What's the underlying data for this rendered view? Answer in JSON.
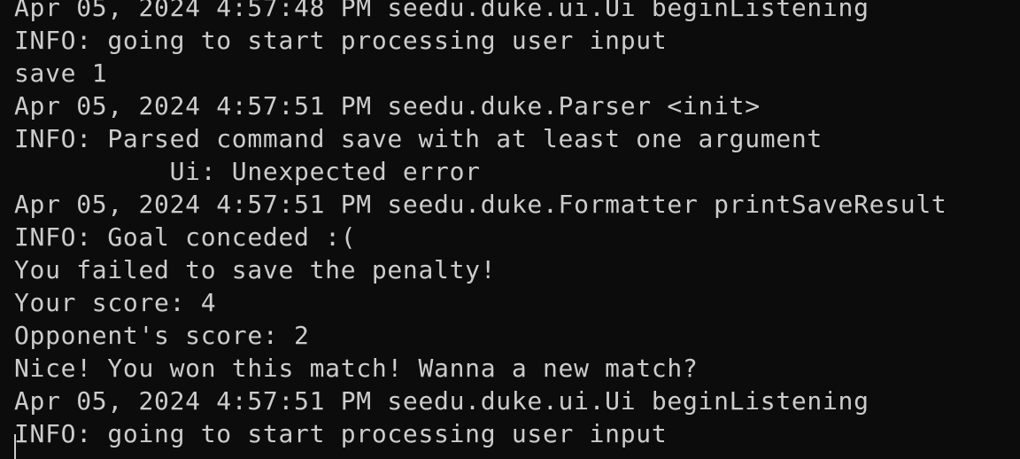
{
  "terminal": {
    "lines": [
      "Apr 05, 2024 4:57:48 PM seedu.duke.ui.Ui beginListening",
      "INFO: going to start processing user input",
      "save 1",
      "Apr 05, 2024 4:57:51 PM seedu.duke.Parser <init>",
      "INFO: Parsed command save with at least one argument",
      "          Ui: Unexpected error",
      "Apr 05, 2024 4:57:51 PM seedu.duke.Formatter printSaveResult",
      "INFO: Goal conceded :(",
      "You failed to save the penalty!",
      "Your score: 4",
      "Opponent's score: 2",
      "Nice! You won this match! Wanna a new match?",
      "Apr 05, 2024 4:57:51 PM seedu.duke.ui.Ui beginListening",
      "INFO: going to start processing user input"
    ],
    "colors": {
      "background": "#0c0c0c",
      "foreground": "#cccccc"
    }
  }
}
